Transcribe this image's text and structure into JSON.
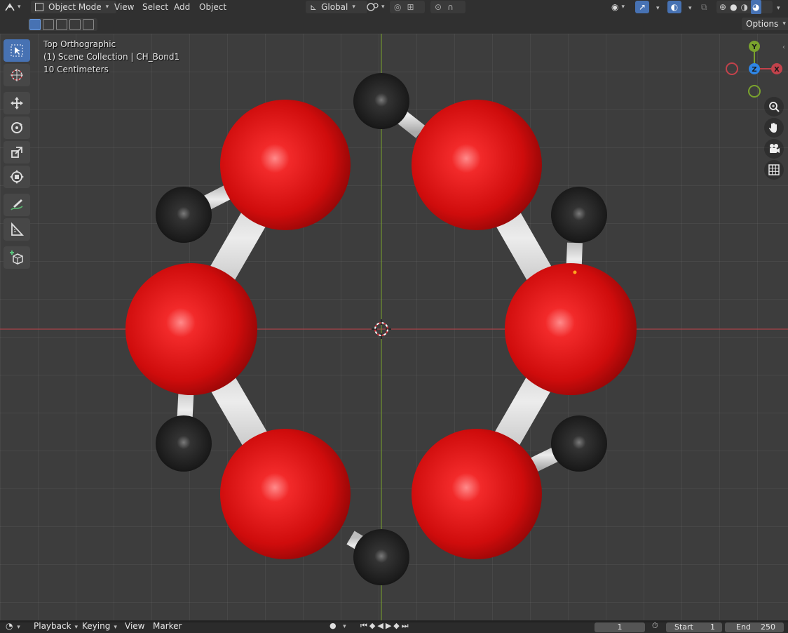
{
  "header": {
    "mode": "Object Mode",
    "menus": [
      "View",
      "Select",
      "Add",
      "Object"
    ],
    "transform_orientation": "Global"
  },
  "subheader": {
    "options_label": "Options"
  },
  "viewport": {
    "view_name": "Top Orthographic",
    "collection_info": "(1) Scene Collection | CH_Bond1",
    "grid_scale": "10 Centimeters"
  },
  "gizmo": {
    "y_label": "Y",
    "z_label": "Z",
    "x_label": "X"
  },
  "timeline": {
    "menus": [
      "Playback",
      "Keying",
      "View",
      "Marker"
    ],
    "current_frame": "1",
    "start_label": "Start",
    "start_value": "1",
    "end_label": "End",
    "end_value": "250"
  },
  "colors": {
    "atom_red": "#d11212",
    "atom_black": "#1e1e1e",
    "bond": "#d6d6d6",
    "axis_x": "#c2424b",
    "axis_y": "#7aa32d",
    "accent": "#4772b3"
  },
  "tools": [
    "select-box-icon",
    "cursor-icon",
    "move-icon",
    "rotate-icon",
    "scale-icon",
    "transform-icon",
    "annotate-icon",
    "measure-icon",
    "add-cube-icon"
  ]
}
